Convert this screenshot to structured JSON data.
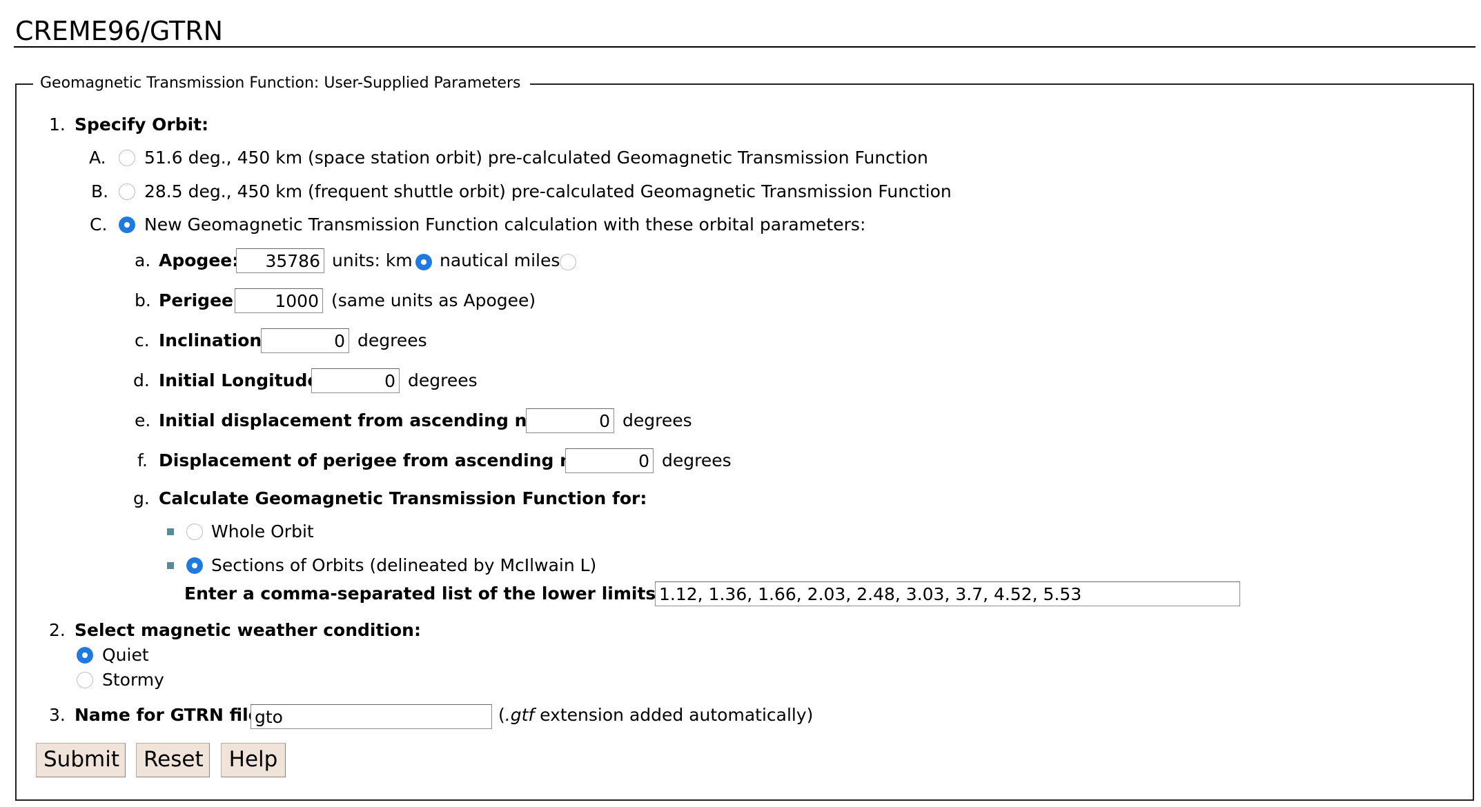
{
  "page_title": "CREME96/GTRN",
  "legend": "Geomagnetic Transmission Function: User-Supplied Parameters",
  "step1": {
    "number": "1.",
    "label": "Specify Orbit:",
    "options": [
      {
        "letter": "A.",
        "text": "51.6 deg., 450 km (space station orbit) pre-calculated Geomagnetic Transmission Function",
        "checked": false
      },
      {
        "letter": "B.",
        "text": "28.5 deg., 450 km (frequent shuttle orbit) pre-calculated Geomagnetic Transmission Function",
        "checked": false
      },
      {
        "letter": "C.",
        "text": "New Geomagnetic Transmission Function calculation with these orbital parameters:",
        "checked": true
      }
    ],
    "params": {
      "apogee": {
        "letter": "a.",
        "label": "Apogee:",
        "value": "35786",
        "units_label": "units: km",
        "km_checked": true,
        "nm_label": "nautical miles",
        "nm_checked": false
      },
      "perigee": {
        "letter": "b.",
        "label": "Perigee:",
        "value": "1000",
        "suffix": "(same units as Apogee)"
      },
      "inclination": {
        "letter": "c.",
        "label": "Inclination:",
        "value": "0",
        "suffix": "degrees"
      },
      "longitude": {
        "letter": "d.",
        "label": "Initial Longitude:",
        "value": "0",
        "suffix": "degrees"
      },
      "displacement": {
        "letter": "e.",
        "label": "Initial displacement from ascending node:",
        "value": "0",
        "suffix": "degrees"
      },
      "perigee_displacement": {
        "letter": "f.",
        "label": "Displacement of perigee from ascending node:",
        "value": "0",
        "suffix": "degrees"
      },
      "calculate": {
        "letter": "g.",
        "label": "Calculate Geomagnetic Transmission Function for:",
        "options": [
          {
            "text": "Whole Orbit",
            "checked": false
          },
          {
            "text": "Sections of Orbits (delineated by McIlwain L)",
            "checked": true
          }
        ],
        "limits_label": "Enter a comma-separated list of the lower limits on L:",
        "limits_value": "1.12, 1.36, 1.66, 2.03, 2.48, 3.03, 3.7, 4.52, 5.53"
      }
    }
  },
  "step2": {
    "number": "2.",
    "label": "Select magnetic weather condition:",
    "options": [
      {
        "text": "Quiet",
        "checked": true
      },
      {
        "text": "Stormy",
        "checked": false
      }
    ]
  },
  "step3": {
    "number": "3.",
    "label": "Name for GTRN file:",
    "value": "gto",
    "hint_prefix": "(",
    "hint_ext": ".gtf",
    "hint_suffix": " extension added automatically)"
  },
  "buttons": {
    "submit": "Submit",
    "reset": "Reset",
    "help": "Help"
  },
  "colors": {
    "radio_checked": "#1f7ae0",
    "button_bg": "#f0e3da",
    "bullet": "#5a8a96"
  }
}
